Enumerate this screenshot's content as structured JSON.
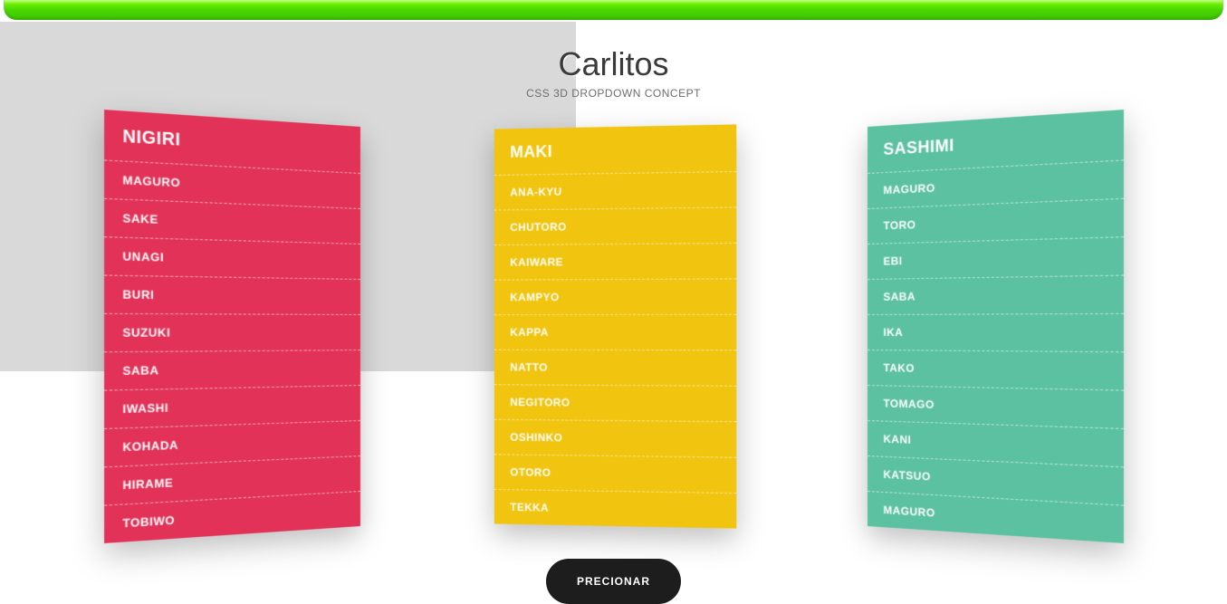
{
  "header": {
    "title": "Carlitos",
    "subtitle": "CSS 3D DROPDOWN CONCEPT"
  },
  "cards": [
    {
      "title": "NIGIRI",
      "color": "pink",
      "tilt": "left",
      "items": [
        "MAGURO",
        "SAKE",
        "UNAGI",
        "BURI",
        "SUZUKI",
        "SABA",
        "IWASHI",
        "KOHADA",
        "HIRAME",
        "TOBIWO"
      ]
    },
    {
      "title": "MAKI",
      "color": "yellow",
      "tilt": "mid",
      "items": [
        "ANA-KYU",
        "CHUTORO",
        "KAIWARE",
        "KAMPYO",
        "KAPPA",
        "NATTO",
        "NEGITORO",
        "OSHINKO",
        "OTORO",
        "TEKKA"
      ]
    },
    {
      "title": "SASHIMI",
      "color": "teal",
      "tilt": "right",
      "items": [
        "MAGURO",
        "TORO",
        "EBI",
        "SABA",
        "IKA",
        "TAKO",
        "TOMAGO",
        "KANI",
        "KATSUO",
        "MAGURO"
      ]
    }
  ],
  "button": {
    "label": "PRECIONAR"
  }
}
